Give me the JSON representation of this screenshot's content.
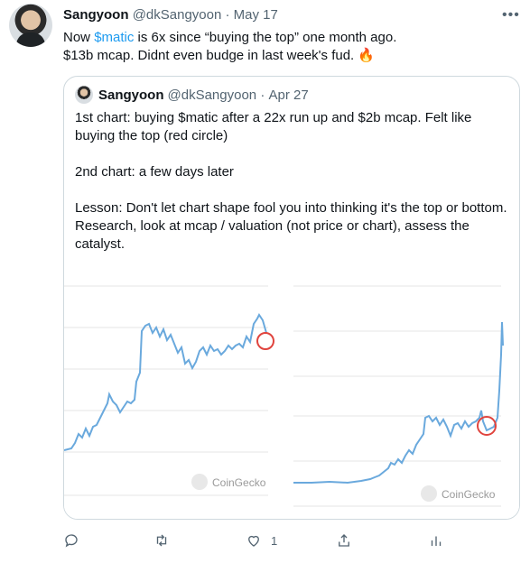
{
  "tweet": {
    "author_name": "Sangyoon",
    "handle": "@dkSangyoon",
    "date": "May 17",
    "text_before_link": "Now ",
    "link_text": "$matic",
    "text_after_link": " is 6x since “buying the top” one month ago.",
    "text_line2": "$13b mcap. Didnt even budge in last week's fud. 🔥",
    "more_icon": "more-icon"
  },
  "quote": {
    "author_name": "Sangyoon",
    "handle": "@dkSangyoon",
    "date": "Apr 27",
    "para1": "1st chart: buying $matic after a 22x run up and $2b mcap. Felt like buying the top (red circle)",
    "para2": "2nd chart: a few days later",
    "para3": "Lesson: Don't let chart shape fool you into thinking it's the top or bottom. Research, look at mcap / valuation (not price or chart), assess the catalyst."
  },
  "charts": {
    "watermark": "CoinGecko",
    "line_color": "#6aa9dd",
    "circle_color": "#e0443e",
    "grid_color": "#e6e6e6"
  },
  "actions": {
    "reply_icon": "reply-icon",
    "retweet_icon": "retweet-icon",
    "like_icon": "like-icon",
    "like_count": "1",
    "share_icon": "share-icon",
    "analytics_icon": "analytics-icon"
  }
}
